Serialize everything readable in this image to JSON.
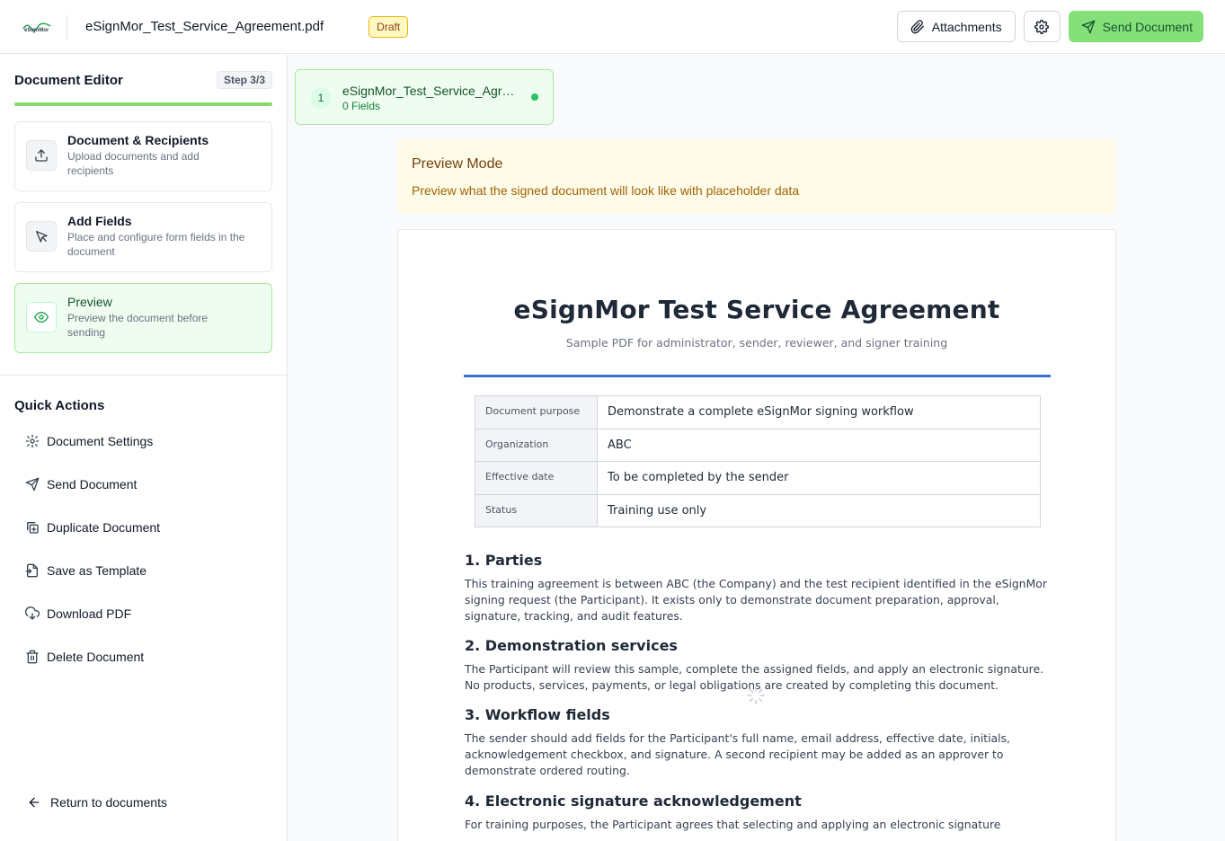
{
  "header": {
    "logo_text": "eSignMor",
    "document_filename": "eSignMor_Test_Service_Agreement.pdf",
    "status_badge": "Draft",
    "attachments_label": "Attachments",
    "send_label": "Send Document"
  },
  "sidebar": {
    "editor_title": "Document Editor",
    "step_indicator": "Step 3/3",
    "steps": [
      {
        "name": "Document & Recipients",
        "description": "Upload documents and add recipients"
      },
      {
        "name": "Add Fields",
        "description": "Place and configure form fields in the document"
      },
      {
        "name": "Preview",
        "description": "Preview the document before sending"
      }
    ],
    "quick_actions_title": "Quick Actions",
    "quick_actions": [
      {
        "label": "Document Settings"
      },
      {
        "label": "Send Document"
      },
      {
        "label": "Duplicate Document"
      },
      {
        "label": "Save as Template"
      },
      {
        "label": "Download PDF"
      },
      {
        "label": "Delete Document"
      }
    ],
    "return_label": "Return to documents"
  },
  "file_tab": {
    "number": "1",
    "name": "eSignMor_Test_Service_Agreement.pdf",
    "fields_count": "0 Fields"
  },
  "preview_banner": {
    "title": "Preview Mode",
    "subtitle": "Preview what the signed document will look like with placeholder data"
  },
  "document": {
    "title": "eSignMor Test Service Agreement",
    "subtitle": "Sample PDF for administrator, sender, reviewer, and signer training",
    "meta": [
      {
        "key": "Document purpose",
        "value": "Demonstrate a complete eSignMor signing workflow"
      },
      {
        "key": "Organization",
        "value": "ABC"
      },
      {
        "key": "Effective date",
        "value": "To be completed by the sender"
      },
      {
        "key": "Status",
        "value": "Training use only"
      }
    ],
    "sections": [
      {
        "heading": "1. Parties",
        "body": "This training agreement is between ABC (the Company) and the test recipient identified in the eSignMor signing request (the Participant). It exists only to demonstrate document preparation, approval, signature, tracking, and audit features."
      },
      {
        "heading": "2. Demonstration services",
        "body": "The Participant will review this sample, complete the assigned fields, and apply an electronic signature. No products, services, payments, or legal obligations are created by completing this document."
      },
      {
        "heading": "3. Workflow fields",
        "body": "The sender should add fields for the Participant's full name, email address, effective date, initials, acknowledgement checkbox, and signature. A second recipient may be added as an approver to demonstrate ordered routing."
      },
      {
        "heading": "4. Electronic signature acknowledgement",
        "body": "For training purposes, the Participant agrees that selecting and applying an electronic signature"
      }
    ]
  }
}
